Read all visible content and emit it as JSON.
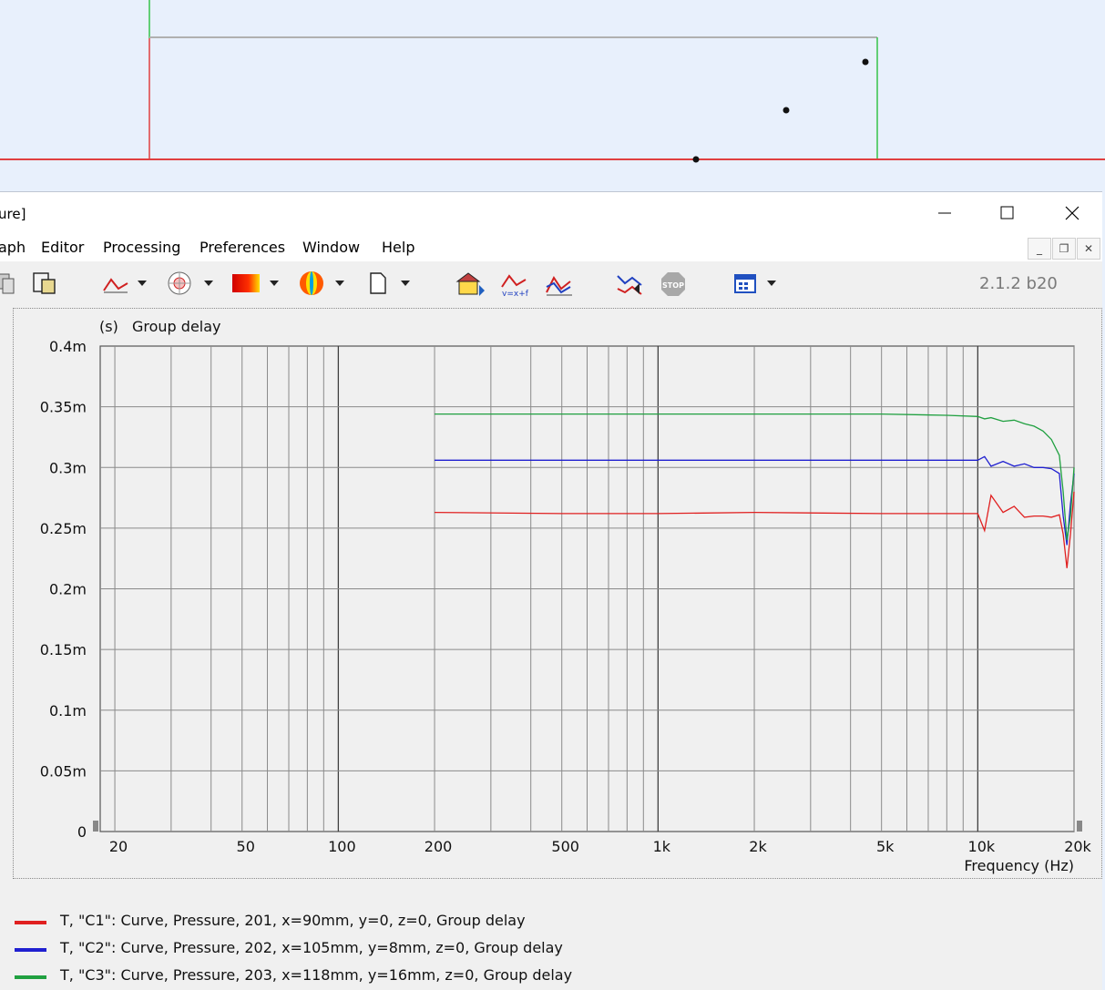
{
  "window": {
    "title_fragment": "ure]",
    "version": "2.1.2 b20",
    "menu": [
      "aph",
      "Editor",
      "Processing",
      "Preferences",
      "Window",
      "Help"
    ]
  },
  "toolbar": {
    "icons": [
      "copy-icon",
      "clipboard-icon",
      "curve-chart-icon",
      "polar-chart-icon",
      "colormap-icon",
      "balloon-icon",
      "new-page-icon",
      "box-import-icon",
      "curve-formula-icon",
      "curve-overlay-icon",
      "export-curve-icon",
      "stop-icon",
      "calendar-icon"
    ]
  },
  "colors": {
    "c1": "#e02020",
    "c2": "#2020d0",
    "c3": "#20a040",
    "background": "#e8f0fc",
    "panel": "#f0f0f0",
    "grid": "#808080"
  },
  "chart_data": {
    "type": "line",
    "title": "Group delay",
    "ylabel_unit": "(s)",
    "xlabel": "Frequency  (Hz)",
    "xscale": "log",
    "xlim": [
      18,
      20000
    ],
    "ylim": [
      0,
      0.0004
    ],
    "x_ticks": [
      "20",
      "50",
      "100",
      "200",
      "500",
      "1k",
      "2k",
      "5k",
      "10k",
      "20k"
    ],
    "y_ticks": [
      "0",
      "0.05m",
      "0.1m",
      "0.15m",
      "0.2m",
      "0.25m",
      "0.3m",
      "0.35m",
      "0.4m"
    ],
    "series": [
      {
        "name": "T, \"C1\": Curve, Pressure, 201, x=90mm, y=0, z=0, Group delay",
        "color": "#e02020",
        "x": [
          200,
          500,
          1000,
          2000,
          5000,
          8000,
          10000,
          10500,
          11000,
          12000,
          13000,
          14000,
          15000,
          16000,
          17000,
          18000,
          18500,
          19000,
          19500,
          20000
        ],
        "y": [
          0.000263,
          0.000262,
          0.000262,
          0.000263,
          0.000262,
          0.000262,
          0.000262,
          0.000248,
          0.000277,
          0.000263,
          0.000268,
          0.000259,
          0.00026,
          0.00026,
          0.000259,
          0.000261,
          0.000245,
          0.000217,
          0.000245,
          0.00028
        ]
      },
      {
        "name": "T, \"C2\": Curve, Pressure, 202, x=105mm, y=8mm, z=0, Group delay",
        "color": "#2020d0",
        "x": [
          200,
          500,
          1000,
          2000,
          5000,
          8000,
          10000,
          10500,
          11000,
          12000,
          13000,
          14000,
          15000,
          16000,
          17000,
          18000,
          18500,
          19000,
          19500,
          20000
        ],
        "y": [
          0.000306,
          0.000306,
          0.000306,
          0.000306,
          0.000306,
          0.000306,
          0.000306,
          0.000309,
          0.000301,
          0.000305,
          0.000301,
          0.000303,
          0.0003,
          0.0003,
          0.000299,
          0.000295,
          0.00026,
          0.000236,
          0.00027,
          0.000295
        ]
      },
      {
        "name": "T, \"C3\": Curve, Pressure, 203, x=118mm, y=16mm, z=0, Group delay",
        "color": "#20a040",
        "x": [
          200,
          500,
          1000,
          2000,
          5000,
          8000,
          10000,
          10500,
          11000,
          12000,
          13000,
          14000,
          15000,
          16000,
          17000,
          18000,
          18500,
          19000,
          19500,
          20000
        ],
        "y": [
          0.000344,
          0.000344,
          0.000344,
          0.000344,
          0.000344,
          0.000343,
          0.000342,
          0.00034,
          0.000341,
          0.000338,
          0.000339,
          0.000336,
          0.000334,
          0.00033,
          0.000323,
          0.00031,
          0.00028,
          0.00024,
          0.00026,
          0.0003
        ]
      }
    ]
  }
}
